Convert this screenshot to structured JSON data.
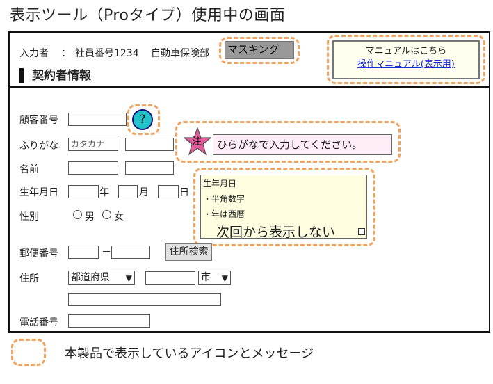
{
  "page_title": "表示ツール（Proタイプ）使用中の画面",
  "header": {
    "user_label": "入力者",
    "separator": "：",
    "employee_number": "社員番号1234",
    "department": "自動車保険部",
    "masking": "マスキング"
  },
  "manual": {
    "caption": "マニュアルはこちら",
    "link": "操作マニュアル(表示用)"
  },
  "section_title": "契約者情報",
  "form": {
    "customer_number_label": "顧客番号",
    "help_icon": "?",
    "furigana_label": "ふりがな",
    "furigana_placeholder": "カタカナ",
    "name_label": "名前",
    "birth_label": "生年月日",
    "year_unit": "年",
    "month_unit": "月",
    "day_unit": "日",
    "gender_label": "性別",
    "gender_male": "男",
    "gender_female": "女",
    "postal_label": "郵便番号",
    "postal_dash": "－",
    "address_search_button": "住所検索",
    "address_label": "住所",
    "prefecture_select": "都道府県",
    "city_select": "市",
    "phone_label": "電話番号"
  },
  "note": {
    "star_label": "注",
    "message": "ひらがなで入力してください。"
  },
  "tip": {
    "title": "生年月日",
    "line1": "・半角数字",
    "line2": "・年は西暦",
    "dismiss": "次回から表示しない"
  },
  "legend": {
    "text": "本製品で表示しているアイコンとメッセージ"
  },
  "colors": {
    "dash_orange": "#f0a35e",
    "help_teal": "#22c3c8",
    "star_pink": "#e65a9c",
    "link_blue": "#1a2bd0"
  }
}
